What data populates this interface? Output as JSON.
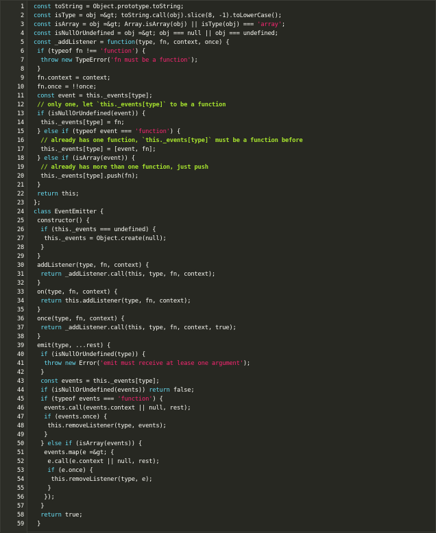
{
  "colors": {
    "background": "#272822",
    "plain": "#f8f8f2",
    "keyword": "#66d9ef",
    "string": "#f92672",
    "comment": "#a6e22e"
  },
  "code_lines": [
    {
      "n": "1",
      "tokens": [
        [
          "k",
          "const"
        ],
        [
          "t",
          " toString = Object.prototype.toString;"
        ]
      ]
    },
    {
      "n": "2",
      "tokens": [
        [
          "k",
          "const"
        ],
        [
          "t",
          " isType = obj =&gt; toString.call(obj).slice(8, -1).toLowerCase();"
        ]
      ]
    },
    {
      "n": "3",
      "tokens": [
        [
          "k",
          "const"
        ],
        [
          "t",
          " isArray = obj =&gt; Array.isArray(obj) || isType(obj) === "
        ],
        [
          "s",
          "'array'"
        ],
        [
          "t",
          ";"
        ]
      ]
    },
    {
      "n": "4",
      "tokens": [
        [
          "k",
          "const"
        ],
        [
          "t",
          " isNullOrUndefined = obj =&gt; obj === null || obj === undefined;"
        ]
      ]
    },
    {
      "n": "5",
      "tokens": [
        [
          "k",
          "const"
        ],
        [
          "t",
          " _addListener = "
        ],
        [
          "k",
          "function"
        ],
        [
          "t",
          "(type, fn, context, once) {"
        ]
      ]
    },
    {
      "n": "6",
      "tokens": [
        [
          "t",
          " "
        ],
        [
          "k",
          "if"
        ],
        [
          "t",
          " (typeof fn !== "
        ],
        [
          "s",
          "'function'"
        ],
        [
          "t",
          ") {"
        ]
      ]
    },
    {
      "n": "7",
      "tokens": [
        [
          "t",
          "  "
        ],
        [
          "k",
          "throw new"
        ],
        [
          "t",
          " TypeError("
        ],
        [
          "s",
          "'fn must be a function'"
        ],
        [
          "t",
          ");"
        ]
      ]
    },
    {
      "n": "8",
      "tokens": [
        [
          "t",
          " }"
        ]
      ]
    },
    {
      "n": "9",
      "tokens": [
        [
          "t",
          " fn.context = context;"
        ]
      ]
    },
    {
      "n": "10",
      "tokens": [
        [
          "t",
          " fn.once = !!once;"
        ]
      ]
    },
    {
      "n": "11",
      "tokens": [
        [
          "t",
          " "
        ],
        [
          "k",
          "const"
        ],
        [
          "t",
          " event = this._events[type];"
        ]
      ]
    },
    {
      "n": "12",
      "tokens": [
        [
          "t",
          " "
        ],
        [
          "c",
          "// only one, let `this._events[type]` to be a function"
        ]
      ]
    },
    {
      "n": "13",
      "tokens": [
        [
          "t",
          " "
        ],
        [
          "k",
          "if"
        ],
        [
          "t",
          " (isNullOrUndefined(event)) {"
        ]
      ]
    },
    {
      "n": "14",
      "tokens": [
        [
          "t",
          "  this._events[type] = fn;"
        ]
      ]
    },
    {
      "n": "15",
      "tokens": [
        [
          "t",
          " } "
        ],
        [
          "k",
          "else if"
        ],
        [
          "t",
          " (typeof event === "
        ],
        [
          "s",
          "'function'"
        ],
        [
          "t",
          ") {"
        ]
      ]
    },
    {
      "n": "16",
      "tokens": [
        [
          "t",
          "  "
        ],
        [
          "c",
          "// already has one function, `this._events[type]` must be a function before"
        ]
      ]
    },
    {
      "n": "17",
      "tokens": [
        [
          "t",
          "  this._events[type] = [event, fn];"
        ]
      ]
    },
    {
      "n": "18",
      "tokens": [
        [
          "t",
          " } "
        ],
        [
          "k",
          "else if"
        ],
        [
          "t",
          " (isArray(event)) {"
        ]
      ]
    },
    {
      "n": "19",
      "tokens": [
        [
          "t",
          "  "
        ],
        [
          "c",
          "// already has more than one function, just push"
        ]
      ]
    },
    {
      "n": "20",
      "tokens": [
        [
          "t",
          "  this._events[type].push(fn);"
        ]
      ]
    },
    {
      "n": "21",
      "tokens": [
        [
          "t",
          " }"
        ]
      ]
    },
    {
      "n": "22",
      "tokens": [
        [
          "t",
          " "
        ],
        [
          "k",
          "return"
        ],
        [
          "t",
          " this;"
        ]
      ]
    },
    {
      "n": "23",
      "tokens": [
        [
          "t",
          "};"
        ]
      ]
    },
    {
      "n": "24",
      "tokens": [
        [
          "k",
          "class"
        ],
        [
          "t",
          " EventEmitter {"
        ]
      ]
    },
    {
      "n": "25",
      "tokens": [
        [
          "t",
          " constructor() {"
        ]
      ]
    },
    {
      "n": "26",
      "tokens": [
        [
          "t",
          "  "
        ],
        [
          "k",
          "if"
        ],
        [
          "t",
          " (this._events === undefined) {"
        ]
      ]
    },
    {
      "n": "27",
      "tokens": [
        [
          "t",
          "   this._events = Object.create(null);"
        ]
      ]
    },
    {
      "n": "28",
      "tokens": [
        [
          "t",
          "  }"
        ]
      ]
    },
    {
      "n": "29",
      "tokens": [
        [
          "t",
          " }"
        ]
      ]
    },
    {
      "n": "30",
      "tokens": [
        [
          "t",
          " addListener(type, fn, context) {"
        ]
      ]
    },
    {
      "n": "31",
      "tokens": [
        [
          "t",
          "  "
        ],
        [
          "k",
          "return"
        ],
        [
          "t",
          " _addListener.call(this, type, fn, context);"
        ]
      ]
    },
    {
      "n": "32",
      "tokens": [
        [
          "t",
          " }"
        ]
      ]
    },
    {
      "n": "33",
      "tokens": [
        [
          "t",
          " on(type, fn, context) {"
        ]
      ]
    },
    {
      "n": "34",
      "tokens": [
        [
          "t",
          "  "
        ],
        [
          "k",
          "return"
        ],
        [
          "t",
          " this.addListener(type, fn, context);"
        ]
      ]
    },
    {
      "n": "35",
      "tokens": [
        [
          "t",
          " }"
        ]
      ]
    },
    {
      "n": "36",
      "tokens": [
        [
          "t",
          " once(type, fn, context) {"
        ]
      ]
    },
    {
      "n": "37",
      "tokens": [
        [
          "t",
          "  "
        ],
        [
          "k",
          "return"
        ],
        [
          "t",
          " _addListener.call(this, type, fn, context, true);"
        ]
      ]
    },
    {
      "n": "38",
      "tokens": [
        [
          "t",
          " }"
        ]
      ]
    },
    {
      "n": "39",
      "tokens": [
        [
          "t",
          " emit(type, ...rest) {"
        ]
      ]
    },
    {
      "n": "40",
      "tokens": [
        [
          "t",
          "  "
        ],
        [
          "k",
          "if"
        ],
        [
          "t",
          " (isNullOrUndefined(type)) {"
        ]
      ]
    },
    {
      "n": "41",
      "tokens": [
        [
          "t",
          "   "
        ],
        [
          "k",
          "throw new"
        ],
        [
          "t",
          " Error("
        ],
        [
          "s",
          "'emit must receive at lease one argument'"
        ],
        [
          "t",
          ");"
        ]
      ]
    },
    {
      "n": "42",
      "tokens": [
        [
          "t",
          "  }"
        ]
      ]
    },
    {
      "n": "43",
      "tokens": [
        [
          "t",
          "  "
        ],
        [
          "k",
          "const"
        ],
        [
          "t",
          " events = this._events[type];"
        ]
      ]
    },
    {
      "n": "44",
      "tokens": [
        [
          "t",
          "  "
        ],
        [
          "k",
          "if"
        ],
        [
          "t",
          " (isNullOrUndefined(events)) "
        ],
        [
          "k",
          "return"
        ],
        [
          "t",
          " false;"
        ]
      ]
    },
    {
      "n": "45",
      "tokens": [
        [
          "t",
          "  "
        ],
        [
          "k",
          "if"
        ],
        [
          "t",
          " (typeof events === "
        ],
        [
          "s",
          "'function'"
        ],
        [
          "t",
          ") {"
        ]
      ]
    },
    {
      "n": "46",
      "tokens": [
        [
          "t",
          "   events.call(events.context || null, rest);"
        ]
      ]
    },
    {
      "n": "47",
      "tokens": [
        [
          "t",
          "   "
        ],
        [
          "k",
          "if"
        ],
        [
          "t",
          " (events.once) {"
        ]
      ]
    },
    {
      "n": "48",
      "tokens": [
        [
          "t",
          "    this.removeListener(type, events);"
        ]
      ]
    },
    {
      "n": "49",
      "tokens": [
        [
          "t",
          "   }"
        ]
      ]
    },
    {
      "n": "50",
      "tokens": [
        [
          "t",
          "  } "
        ],
        [
          "k",
          "else if"
        ],
        [
          "t",
          " (isArray(events)) {"
        ]
      ]
    },
    {
      "n": "51",
      "tokens": [
        [
          "t",
          "   events.map(e =&gt; {"
        ]
      ]
    },
    {
      "n": "52",
      "tokens": [
        [
          "t",
          "    e.call(e.context || null, rest);"
        ]
      ]
    },
    {
      "n": "53",
      "tokens": [
        [
          "t",
          "    "
        ],
        [
          "k",
          "if"
        ],
        [
          "t",
          " (e.once) {"
        ]
      ]
    },
    {
      "n": "54",
      "tokens": [
        [
          "t",
          "     this.removeListener(type, e);"
        ]
      ]
    },
    {
      "n": "55",
      "tokens": [
        [
          "t",
          "    }"
        ]
      ]
    },
    {
      "n": "56",
      "tokens": [
        [
          "t",
          "   });"
        ]
      ]
    },
    {
      "n": "57",
      "tokens": [
        [
          "t",
          "  }"
        ]
      ]
    },
    {
      "n": "58",
      "tokens": [
        [
          "t",
          "  "
        ],
        [
          "k",
          "return"
        ],
        [
          "t",
          " true;"
        ]
      ]
    },
    {
      "n": "59",
      "tokens": [
        [
          "t",
          " }"
        ]
      ]
    }
  ]
}
